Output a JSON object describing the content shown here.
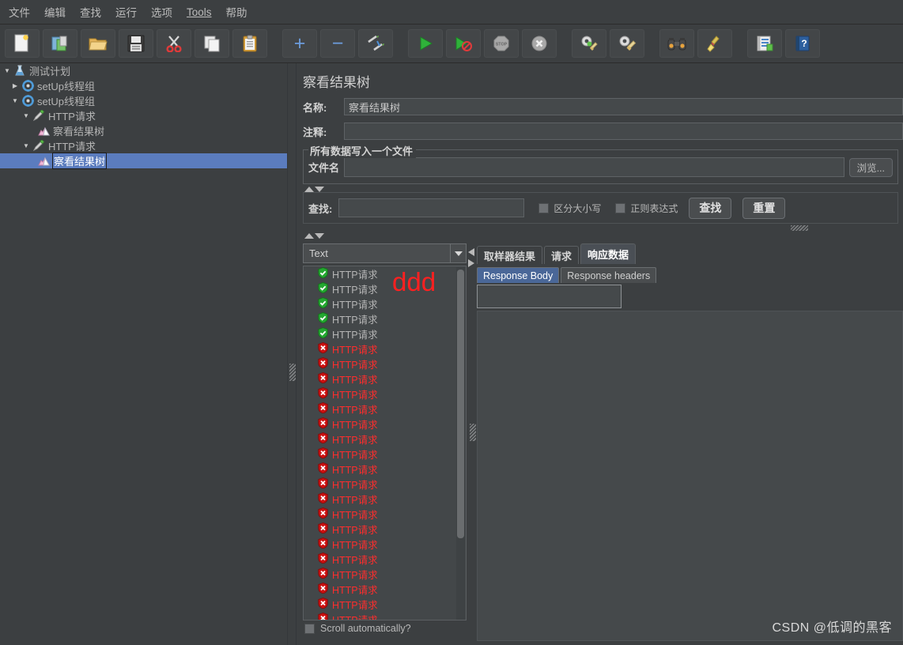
{
  "menu": {
    "items": [
      {
        "label": "文件",
        "mnemonic": ""
      },
      {
        "label": "编辑",
        "mnemonic": ""
      },
      {
        "label": "查找",
        "mnemonic": ""
      },
      {
        "label": "运行",
        "mnemonic": ""
      },
      {
        "label": "选项",
        "mnemonic": ""
      },
      {
        "label": "Tools",
        "mnemonic": "T"
      },
      {
        "label": "帮助",
        "mnemonic": ""
      }
    ]
  },
  "toolbar": {
    "buttons": [
      {
        "name": "new-button",
        "icon": "new-document-icon"
      },
      {
        "name": "templates-button",
        "icon": "templates-icon"
      },
      {
        "name": "open-button",
        "icon": "open-folder-icon"
      },
      {
        "name": "save-button",
        "icon": "floppy-save-icon"
      },
      {
        "name": "cut-button",
        "icon": "scissors-icon"
      },
      {
        "name": "copy-button",
        "icon": "copy-icon"
      },
      {
        "name": "paste-button",
        "icon": "clipboard-paste-icon"
      },
      {
        "name": "expand-button",
        "icon": "plus-icon",
        "glyph": "+"
      },
      {
        "name": "collapse-button",
        "icon": "minus-icon",
        "glyph": "−"
      },
      {
        "name": "toggle-button",
        "icon": "toggle-pencils-icon"
      },
      {
        "name": "start-button",
        "icon": "play-green-icon"
      },
      {
        "name": "start-no-pauses-button",
        "icon": "play-no-pauses-icon"
      },
      {
        "name": "stop-button",
        "icon": "stop-sign-icon"
      },
      {
        "name": "shutdown-button",
        "icon": "shutdown-x-icon"
      },
      {
        "name": "clear-button",
        "icon": "clear-gear-broom-icon"
      },
      {
        "name": "clear-all-button",
        "icon": "clear-all-broom-icon"
      },
      {
        "name": "search-button",
        "icon": "binoculars-icon"
      },
      {
        "name": "reset-search-button",
        "icon": "broom-icon"
      },
      {
        "name": "function-helper-button",
        "icon": "function-helper-icon"
      },
      {
        "name": "help-button",
        "icon": "help-book-icon"
      }
    ]
  },
  "tree": {
    "nodes": [
      {
        "label": "测试计划",
        "indent": 0,
        "toggle": "collapsed-down",
        "icon": "test-plan-icon",
        "selected": false
      },
      {
        "label": "setUp线程组",
        "indent": 1,
        "toggle": "collapsed-right",
        "icon": "thread-group-icon",
        "selected": false
      },
      {
        "label": "setUp线程组",
        "indent": 1,
        "toggle": "expanded-down",
        "icon": "thread-group-icon",
        "selected": false
      },
      {
        "label": "HTTP请求",
        "indent": 2,
        "toggle": "expanded-down",
        "icon": "http-sampler-icon",
        "selected": false
      },
      {
        "label": "察看结果树",
        "indent": 3,
        "toggle": "none",
        "icon": "view-results-tree-icon",
        "selected": false
      },
      {
        "label": "HTTP请求",
        "indent": 2,
        "toggle": "expanded-down",
        "icon": "http-sampler-icon",
        "selected": false
      },
      {
        "label": "察看结果树",
        "indent": 3,
        "toggle": "none",
        "icon": "view-results-tree-icon",
        "selected": true
      }
    ]
  },
  "panel": {
    "title": "察看结果树",
    "name_label": "名称:",
    "name_value": "察看结果树",
    "comment_label": "注释:",
    "comment_value": "",
    "file_group_title": "所有数据写入一个文件",
    "filename_label": "文件名",
    "filename_value": "",
    "browse_label": "浏览..."
  },
  "search": {
    "label": "查找:",
    "value": "",
    "case_sensitive_label": "区分大小写",
    "case_sensitive_checked": false,
    "regex_label": "正则表达式",
    "regex_checked": false,
    "find_button": "查找",
    "reset_button": "重置"
  },
  "results": {
    "renderer_selected": "Text",
    "scroll_label": "Scroll automatically?",
    "scroll_checked": false,
    "annotation": "ddd",
    "entries": [
      {
        "label": "HTTP请求",
        "status": "ok"
      },
      {
        "label": "HTTP请求",
        "status": "ok"
      },
      {
        "label": "HTTP请求",
        "status": "ok"
      },
      {
        "label": "HTTP请求",
        "status": "ok"
      },
      {
        "label": "HTTP请求",
        "status": "ok"
      },
      {
        "label": "HTTP请求",
        "status": "fail"
      },
      {
        "label": "HTTP请求",
        "status": "fail"
      },
      {
        "label": "HTTP请求",
        "status": "fail"
      },
      {
        "label": "HTTP请求",
        "status": "fail"
      },
      {
        "label": "HTTP请求",
        "status": "fail"
      },
      {
        "label": "HTTP请求",
        "status": "fail"
      },
      {
        "label": "HTTP请求",
        "status": "fail"
      },
      {
        "label": "HTTP请求",
        "status": "fail"
      },
      {
        "label": "HTTP请求",
        "status": "fail"
      },
      {
        "label": "HTTP请求",
        "status": "fail"
      },
      {
        "label": "HTTP请求",
        "status": "fail"
      },
      {
        "label": "HTTP请求",
        "status": "fail"
      },
      {
        "label": "HTTP请求",
        "status": "fail"
      },
      {
        "label": "HTTP请求",
        "status": "fail"
      },
      {
        "label": "HTTP请求",
        "status": "fail"
      },
      {
        "label": "HTTP请求",
        "status": "fail"
      },
      {
        "label": "HTTP请求",
        "status": "fail"
      },
      {
        "label": "HTTP请求",
        "status": "fail"
      },
      {
        "label": "HTTP请求",
        "status": "fail"
      }
    ]
  },
  "detail": {
    "tabs": [
      {
        "label": "取样器结果",
        "active": false
      },
      {
        "label": "请求",
        "active": false
      },
      {
        "label": "响应数据",
        "active": true
      }
    ],
    "subtabs": [
      {
        "label": "Response Body",
        "active": true
      },
      {
        "label": "Response headers",
        "active": false
      }
    ],
    "response_search_value": "",
    "response_body_value": ""
  },
  "watermark": "CSDN @低调的黑客",
  "colors": {
    "background": "#3c3f41",
    "selection_blue": "#5b7cbe",
    "subtab_active_blue": "#4a6798",
    "fail_red": "#ff2d2d",
    "success_green": "#23a13a",
    "text": "#b4b4b4"
  }
}
